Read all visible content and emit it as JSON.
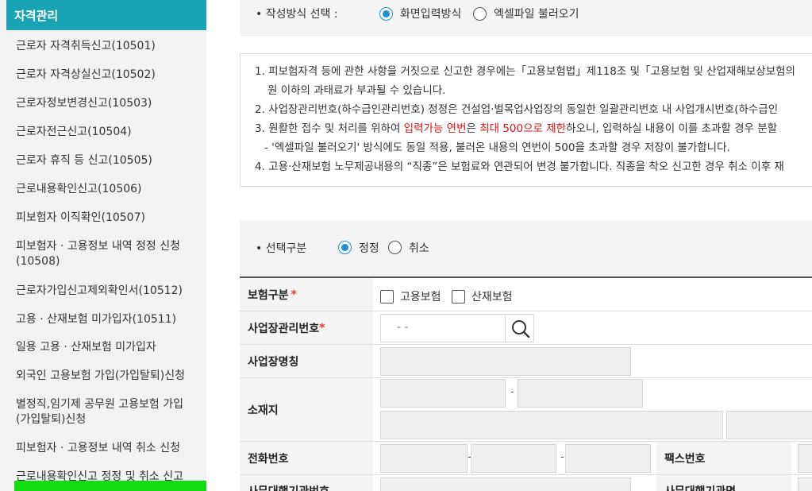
{
  "sidebar": {
    "header": "자격관리",
    "items": [
      "근로자 자격취득신고(10501)",
      "근로자 자격상실신고(10502)",
      "근로자정보변경신고(10503)",
      "근로자전근신고(10504)",
      "근로자 휴직 등 신고(10505)",
      "근로내용확인신고(10506)",
      "피보험자 이직확인(10507)",
      "피보험자 · 고용정보 내역 정정 신청",
      "(10508)",
      "근로자가입신고제외확인서(10512)",
      "고용 · 산재보험 미가입자(10511)",
      "일용 고용 · 산재보험 미가입자",
      "외국인 고용보험 가입(가입탈퇴)신청",
      "별정직,임기제 공무원 고용보험 가입",
      "(가입탈퇴)신청",
      "피보험자 · 고용정보 내역 취소 신청",
      "근로내용확인신고 정정 및 취소 신고"
    ]
  },
  "method": {
    "label": "• 작성방식 선택 :",
    "option1": "화면입력방식",
    "option2": "엑셀파일 불러오기",
    "selected": "화면입력방식"
  },
  "notice": {
    "l1": "1. 피보험자격 등에 관한 사항을 거짓으로 신고한 경우에는「고용보험법」제118조 및「고용보험 및 산업재해보상보험의",
    "l1b": "원 이하의 과태료가 부과될 수 있습니다.",
    "l2": "2. 사업장관리번호(하수급인관리번호) 정정은 건설업·벌목업사업장의 동일한 일괄관리번호 내 사업개시번호(하수급인",
    "l3a": "3. 원활한 접수 및 처리를 위하여 ",
    "l3b": "입력가능 연번",
    "l3c": "은 ",
    "l3d": "최대 500으로 제한",
    "l3e": "하오니, 입력하실 내용이 이를 초과할 경우 분할",
    "l3sub": "- '엑셀파일 불러오기' 방식에도 동일 적용, 불러온 내용의 연번이 500을 초과할 경우 저장이 불가합니다.",
    "l4": "4. 고용·산재보험 노무제공내용의 “직종”은 보험료와 연관되어 변경 불가합니다. 직종을 착오 신고한 경우 취소 이후 재"
  },
  "selection": {
    "label": "• 선택구분",
    "option1": "정정",
    "option2": "취소",
    "selected": "정정"
  },
  "form": {
    "insurance_type_label": "보험구분",
    "employment_insurance": "고용보험",
    "industrial_insurance": "산재보험",
    "workplace_no_label": "사업장관리번호",
    "workplace_no_placeholder": " -  -",
    "workplace_name_label": "사업장명칭",
    "address_label": "소재지",
    "address_sep": "-",
    "phone_label": "전화번호",
    "phone_sep1": "-",
    "phone_sep2": "-",
    "fax_label": "팩스번호",
    "agent_no_label": "사무대행기관번호",
    "agent_name_label": "사무대행기관명",
    "required_mark": "*"
  }
}
